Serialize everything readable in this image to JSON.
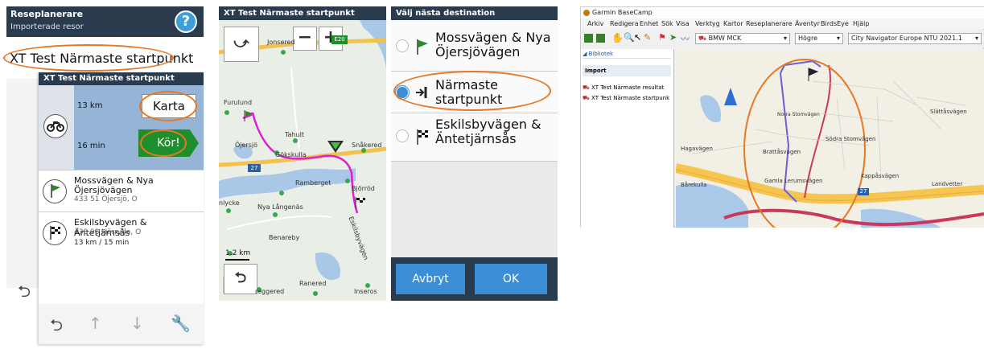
{
  "panel1": {
    "header_title": "Reseplanerare",
    "header_sub": "Importerade resor",
    "help": "?",
    "route_name": "XT Test Närmaste startpunkt",
    "card_title": "XT Test Närmaste startpunkt",
    "distance": "13 km",
    "time": "16 min",
    "map_button": "Karta",
    "go_button": "Kör!",
    "waypoints": [
      {
        "name_line1": "Mossvägen & Nya",
        "name_line2": "Öjersjövägen",
        "address": "433 51 Öjersjö, O"
      },
      {
        "name_line1": "Eskilsbyvägen & Äntetjärnsås",
        "address": "438 93 Härryda, O",
        "extra": "13 km / 15 min"
      }
    ]
  },
  "panel2": {
    "header": "XT Test Närmaste startpunkt",
    "labels": {
      "jonsered": "Jonsered",
      "furulund": "Furulund",
      "tahult": "Tahult",
      "ojersjo": "Öjersjö",
      "gokskulla": "Gökskulla",
      "snakered": "Snåkered",
      "ramberget": "Ramberget",
      "bjorrod": "Björröd",
      "nylycke": "nlycke",
      "nya_langenas": "Nya Långenäs",
      "benareby": "Benareby",
      "eskilsbyvagen": "Eskilsbyvägen",
      "ranered": "Ranered",
      "reggered": "reggered",
      "inseros": "Inseros"
    },
    "road_e20": "E20",
    "road_27": "27",
    "scale": "1.2 km"
  },
  "panel3": {
    "header": "Välj nästa destination",
    "options": [
      {
        "line1": "Mossvägen & Nya",
        "line2": "Öjersjövägen"
      },
      {
        "line1": "Närmaste",
        "line2": "startpunkt"
      },
      {
        "line1": "Eskilsbyvägen &",
        "line2": "Äntetjärnsås"
      }
    ],
    "cancel": "Avbryt",
    "ok": "OK"
  },
  "panel4": {
    "app_title": "Garmin BaseCamp",
    "menu": [
      "Arkiv",
      "Redigera",
      "Enhet",
      "Sök",
      "Visa",
      "Verktyg",
      "Kartor",
      "Reseplanerare",
      "Äventyr",
      "BirdsEye",
      "Hjälp"
    ],
    "profile": "BMW MCK",
    "direction": "Högre",
    "map_product": "City Navigator Europe NTU 2021.1",
    "library": "Bibliotek",
    "import": "Import",
    "items": [
      "XT Test Närmaste resultat",
      "XT Test Närmaste startpunk"
    ],
    "map_labels": {
      "hagavagen": "Hagavägen",
      "brattasvagen": "Brattåsvägen",
      "gamla_lerumsvagen": "Gamla Lerumsvägen",
      "sodra_stomvagen": "Södra Stomvägen",
      "kappasvagen": "Kappåsvägen",
      "landvetter": "Landvetter",
      "slattasvagen": "Slättåsvägen",
      "barekulla": "Bårekulla",
      "road_27": "27",
      "nordstomvagen": "Norra Stomvägen"
    }
  }
}
